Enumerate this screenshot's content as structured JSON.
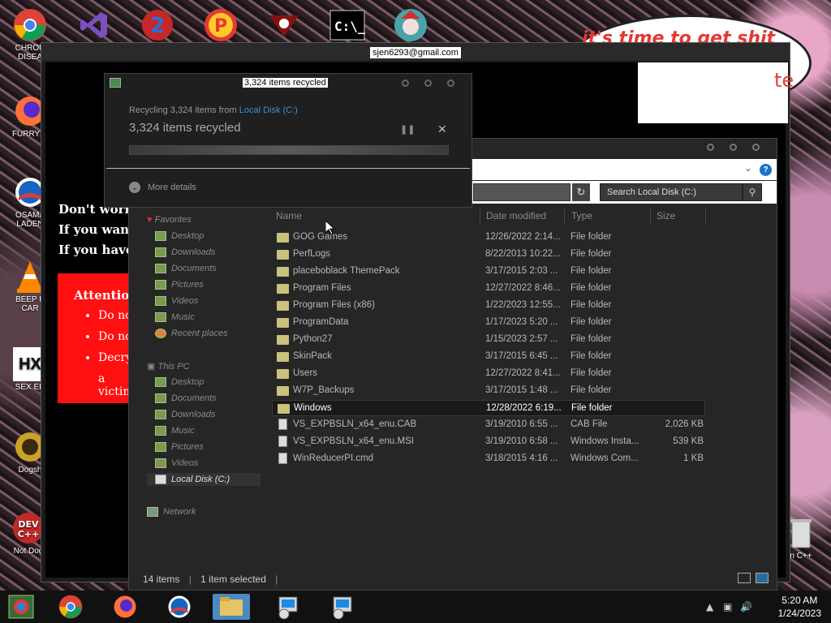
{
  "desktop": {
    "icons": [
      {
        "label": "CHRON\nDISEA",
        "icon": "chrome-icon"
      },
      {
        "label": "FURRY C",
        "icon": "firefox-icon"
      },
      {
        "label": "OSAMA\nLADEN",
        "icon": "obama-icon"
      },
      {
        "label": "BEEP B\nCAR",
        "icon": "vlc-icon"
      },
      {
        "label": "SEX ED",
        "icon": "hx-icon"
      },
      {
        "label": "Dogsh",
        "icon": "dog-icon"
      },
      {
        "label": "Not Dog",
        "icon": "devcpp-icon"
      },
      {
        "label": "n C++",
        "icon": "recycle-bin-icon"
      }
    ],
    "top_banner": "it's time to get shit",
    "top_banner_tail": "te"
  },
  "background_window": {
    "title": "sjen6293@gmail.com",
    "lines": [
      "Don't worry,",
      "If you want t",
      "If you have n"
    ],
    "attention": "Attention!",
    "bullets": [
      "Do not",
      "Do not",
      "Decryp"
    ],
    "bullet_cont": "a victin"
  },
  "dialog": {
    "title": "3,324 items recycled",
    "subtitle_prefix": "Recycling 3,324 items from ",
    "subtitle_link": "Local Disk (C:)",
    "status": "3,324 items recycled",
    "pause_icon": "pause-icon",
    "close_icon": "close-icon",
    "progress": 1.0,
    "more_details": "More details"
  },
  "explorer": {
    "search_placeholder": "Search Local Disk (C:)",
    "nav": {
      "favorites_header": "Favorites",
      "favorites": [
        "Desktop",
        "Downloads",
        "Documents",
        "Pictures",
        "Videos",
        "Music",
        "Recent places"
      ],
      "thispc_header": "This PC",
      "thispc": [
        "Desktop",
        "Documents",
        "Downloads",
        "Music",
        "Pictures",
        "Videos",
        "Local Disk (C:)"
      ],
      "network": "Network"
    },
    "columns": [
      "Name",
      "Date modified",
      "Type",
      "Size"
    ],
    "rows": [
      {
        "name": "GOG Games",
        "date": "12/26/2022 2:14...",
        "type": "File folder",
        "size": "",
        "kind": "folder"
      },
      {
        "name": "PerfLogs",
        "date": "8/22/2013 10:22...",
        "type": "File folder",
        "size": "",
        "kind": "folder"
      },
      {
        "name": "placeboblack ThemePack",
        "date": "3/17/2015 2:03 ...",
        "type": "File folder",
        "size": "",
        "kind": "folder"
      },
      {
        "name": "Program Files",
        "date": "12/27/2022 8:46...",
        "type": "File folder",
        "size": "",
        "kind": "folder"
      },
      {
        "name": "Program Files (x86)",
        "date": "1/22/2023 12:55...",
        "type": "File folder",
        "size": "",
        "kind": "folder"
      },
      {
        "name": "ProgramData",
        "date": "1/17/2023 5:20 ...",
        "type": "File folder",
        "size": "",
        "kind": "folder"
      },
      {
        "name": "Python27",
        "date": "1/15/2023 2:57 ...",
        "type": "File folder",
        "size": "",
        "kind": "folder"
      },
      {
        "name": "SkinPack",
        "date": "3/17/2015 6:45 ...",
        "type": "File folder",
        "size": "",
        "kind": "folder"
      },
      {
        "name": "Users",
        "date": "12/27/2022 8:41...",
        "type": "File folder",
        "size": "",
        "kind": "folder"
      },
      {
        "name": "W7P_Backups",
        "date": "3/17/2015 1:48 ...",
        "type": "File folder",
        "size": "",
        "kind": "folder"
      },
      {
        "name": "Windows",
        "date": "12/28/2022 6:19...",
        "type": "File folder",
        "size": "",
        "kind": "folder",
        "selected": true
      },
      {
        "name": "VS_EXPBSLN_x64_enu.CAB",
        "date": "3/19/2010 6:55 ...",
        "type": "CAB File",
        "size": "2,026 KB",
        "kind": "file"
      },
      {
        "name": "VS_EXPBSLN_x64_enu.MSI",
        "date": "3/19/2010 6:58 ...",
        "type": "Windows Insta...",
        "size": "539 KB",
        "kind": "file"
      },
      {
        "name": "WinReducerPI.cmd",
        "date": "3/18/2015 4:16 ...",
        "type": "Windows Com...",
        "size": "1 KB",
        "kind": "file"
      }
    ],
    "status_items": "14 items",
    "status_selected": "1 item selected"
  },
  "taskbar": {
    "time": "5:20 AM",
    "date": "1/24/2023"
  }
}
